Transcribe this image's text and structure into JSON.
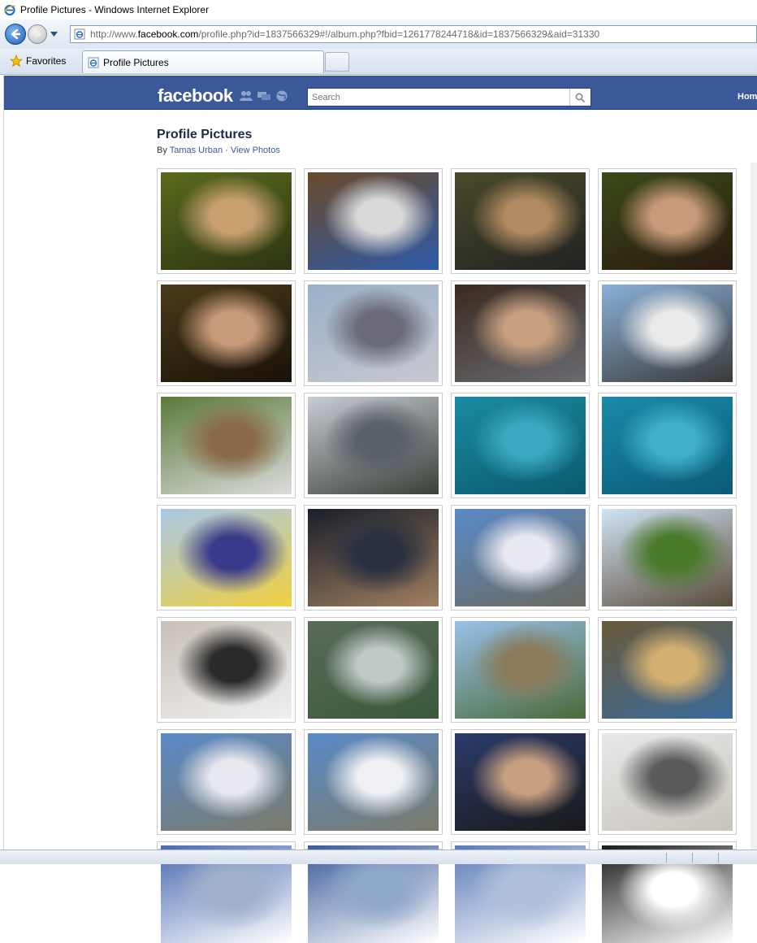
{
  "window": {
    "title": "Profile Pictures - Windows Internet Explorer"
  },
  "browser": {
    "address_prefix": "http://www.",
    "address_host": "facebook.com",
    "address_rest": "/profile.php?id=1837566329#!/album.php?fbid=1261778244718&id=1837566329&aid=31330",
    "favorites_label": "Favorites",
    "tab_label": "Profile Pictures"
  },
  "fb": {
    "logo": "facebook",
    "search_placeholder": "Search",
    "home_label": "Hom",
    "brand_color": "#3b5998"
  },
  "album": {
    "title": "Profile Pictures",
    "by_prefix": "By ",
    "owner": "Tamas Urban",
    "separator": " · ",
    "view_photos": "View Photos"
  },
  "photos": [
    {
      "id": "p1",
      "palette": [
        "#5a6a1c",
        "#c8a070",
        "#2c3412"
      ]
    },
    {
      "id": "p2",
      "palette": [
        "#6a4a2a",
        "#d9d9d9",
        "#2e5aa8"
      ]
    },
    {
      "id": "p3",
      "palette": [
        "#4a4a2a",
        "#b08a60",
        "#222"
      ]
    },
    {
      "id": "p4",
      "palette": [
        "#3a4a1a",
        "#c99a7a",
        "#2a1a10"
      ]
    },
    {
      "id": "p5",
      "palette": [
        "#4a3a1a",
        "#c79a7a",
        "#1a1208"
      ]
    },
    {
      "id": "p6",
      "palette": [
        "#9ab0c8",
        "#6a6a78",
        "#c8c8d0"
      ]
    },
    {
      "id": "p7",
      "palette": [
        "#3a2a20",
        "#c8a080",
        "#6a6a70"
      ]
    },
    {
      "id": "p8",
      "palette": [
        "#8ab0d8",
        "#eaeaea",
        "#3a3a3a"
      ]
    },
    {
      "id": "p9",
      "palette": [
        "#5a7a3a",
        "#8a6a4a",
        "#dcdcdc"
      ]
    },
    {
      "id": "p10",
      "palette": [
        "#c8ccd4",
        "#5a6068",
        "#3a4038"
      ]
    },
    {
      "id": "p11",
      "palette": [
        "#1a8aa0",
        "#3aa8c0",
        "#0a5a70"
      ]
    },
    {
      "id": "p12",
      "palette": [
        "#1a8aa8",
        "#40b0c8",
        "#0a5a78"
      ]
    },
    {
      "id": "p13",
      "palette": [
        "#a8c8e8",
        "#3a3a8a",
        "#f0d040"
      ]
    },
    {
      "id": "p14",
      "palette": [
        "#1a1e2a",
        "#2a3040",
        "#a08060"
      ]
    },
    {
      "id": "p15",
      "palette": [
        "#5a8ac8",
        "#e8e8f0",
        "#6a6a60"
      ]
    },
    {
      "id": "p16",
      "palette": [
        "#d0e4f4",
        "#4a7a2a",
        "#5a4a3a"
      ]
    },
    {
      "id": "p17",
      "palette": [
        "#c8c0b8",
        "#2a2a2a",
        "#efefef"
      ]
    },
    {
      "id": "p18",
      "palette": [
        "#5a6a5a",
        "#c0c8c8",
        "#3a5a3a"
      ]
    },
    {
      "id": "p19",
      "palette": [
        "#9ac0e8",
        "#8a7a5a",
        "#4a6a3a"
      ]
    },
    {
      "id": "p20",
      "palette": [
        "#6a5a3a",
        "#d4b070",
        "#3a6a9a"
      ]
    },
    {
      "id": "p21",
      "palette": [
        "#5a8ac8",
        "#e8e8f0",
        "#7a7a6a"
      ]
    },
    {
      "id": "p22",
      "palette": [
        "#5a8ac8",
        "#eef0f4",
        "#7a7a6a"
      ]
    },
    {
      "id": "p23",
      "palette": [
        "#2a3a6a",
        "#c8a080",
        "#1a1a1a"
      ]
    },
    {
      "id": "p24",
      "palette": [
        "#e8e8e8",
        "#5a5a5a",
        "#c8c4bc"
      ]
    },
    {
      "id": "p25",
      "palette": [
        "#4a6ab0",
        "#a0b0c8",
        "#fff"
      ]
    },
    {
      "id": "p26",
      "palette": [
        "#3a5a9a",
        "#90a8c8",
        "#fff"
      ]
    },
    {
      "id": "p27",
      "palette": [
        "#5a7ab8",
        "#b0c0d8",
        "#fff"
      ]
    },
    {
      "id": "p28",
      "palette": [
        "#1a1a1a",
        "#fff",
        "#fff"
      ]
    }
  ]
}
